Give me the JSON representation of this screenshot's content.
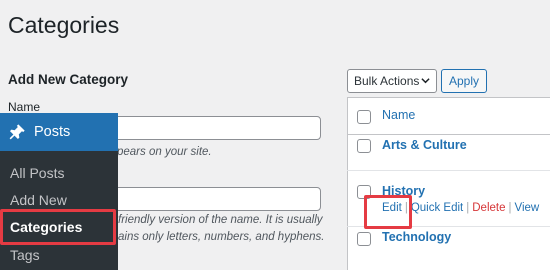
{
  "page": {
    "title": "Categories"
  },
  "form": {
    "heading": "Add New Category",
    "name_label": "Name",
    "name_help": "pears on your site.",
    "slug_help_line1": "friendly version of the name. It is usually",
    "slug_help_line2": "ains only letters, numbers, and hyphens."
  },
  "admin_menu": {
    "section": "Posts",
    "items": [
      "All Posts",
      "Add New",
      "Categories",
      "Tags"
    ],
    "active_item": "Categories"
  },
  "toolbar": {
    "bulk_actions": "Bulk Actions",
    "apply": "Apply"
  },
  "table": {
    "header": "Name",
    "rows": [
      "Arts & Culture",
      "History",
      "Technology"
    ],
    "row_actions": [
      "Edit",
      "Quick Edit",
      "Delete",
      "View"
    ],
    "row_actions_row": "History"
  },
  "colors": {
    "accent_blue": "#2271b1",
    "menu_dark": "#2c3338",
    "highlight_red": "#e53b43",
    "delete_red": "#d63638"
  }
}
